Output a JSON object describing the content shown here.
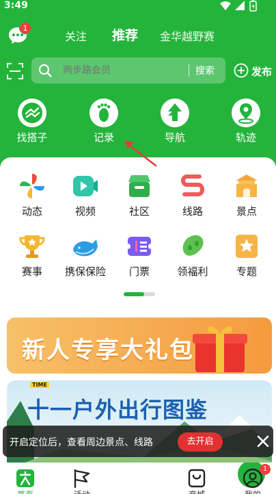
{
  "status": {
    "time": "3:49"
  },
  "topnav": {
    "message_badge": "1",
    "tabs": [
      {
        "label": "关注"
      },
      {
        "label": "推荐"
      },
      {
        "label": "金华越野赛"
      }
    ]
  },
  "search": {
    "placeholder": "两步路会员",
    "button": "搜索",
    "publish": "发布"
  },
  "quick_actions": [
    {
      "label": "找搭子",
      "icon": "partner-icon"
    },
    {
      "label": "记录",
      "icon": "footprint-icon"
    },
    {
      "label": "导航",
      "icon": "navigation-icon"
    },
    {
      "label": "轨迹",
      "icon": "track-icon"
    }
  ],
  "categories": [
    {
      "label": "动态",
      "icon": "pinwheel-icon"
    },
    {
      "label": "视频",
      "icon": "video-icon"
    },
    {
      "label": "社区",
      "icon": "community-icon"
    },
    {
      "label": "线路",
      "icon": "route-icon"
    },
    {
      "label": "景点",
      "icon": "scenic-spot-icon"
    },
    {
      "label": "赛事",
      "icon": "trophy-icon"
    },
    {
      "label": "携保保险",
      "icon": "whale-icon"
    },
    {
      "label": "门票",
      "icon": "ticket-icon"
    },
    {
      "label": "领福利",
      "icon": "bean-icon"
    },
    {
      "label": "专题",
      "icon": "star-topic-icon"
    }
  ],
  "pager": {
    "active_page": 1,
    "page_count": 2
  },
  "banners": [
    {
      "text": "新人专享大礼包"
    },
    {
      "text": "十一户外出行图鉴",
      "tag": "TIME"
    }
  ],
  "toast": {
    "message": "开启定位后，查看周边景点、线路",
    "action": "去开启"
  },
  "bottom_nav": [
    {
      "label": "首页",
      "icon": "home-icon",
      "active": true
    },
    {
      "label": "活动",
      "icon": "flag-icon",
      "active": false
    },
    {
      "label": "",
      "icon": "runner-icon",
      "active": false
    },
    {
      "label": "商城",
      "icon": "bag-icon",
      "active": false
    },
    {
      "label": "我的",
      "icon": "profile-icon",
      "badge": "1",
      "active": false
    }
  ],
  "colors": {
    "brand_green": "#24b43c",
    "badge_red": "#ff3b3b",
    "toast_button": "#e33030"
  }
}
